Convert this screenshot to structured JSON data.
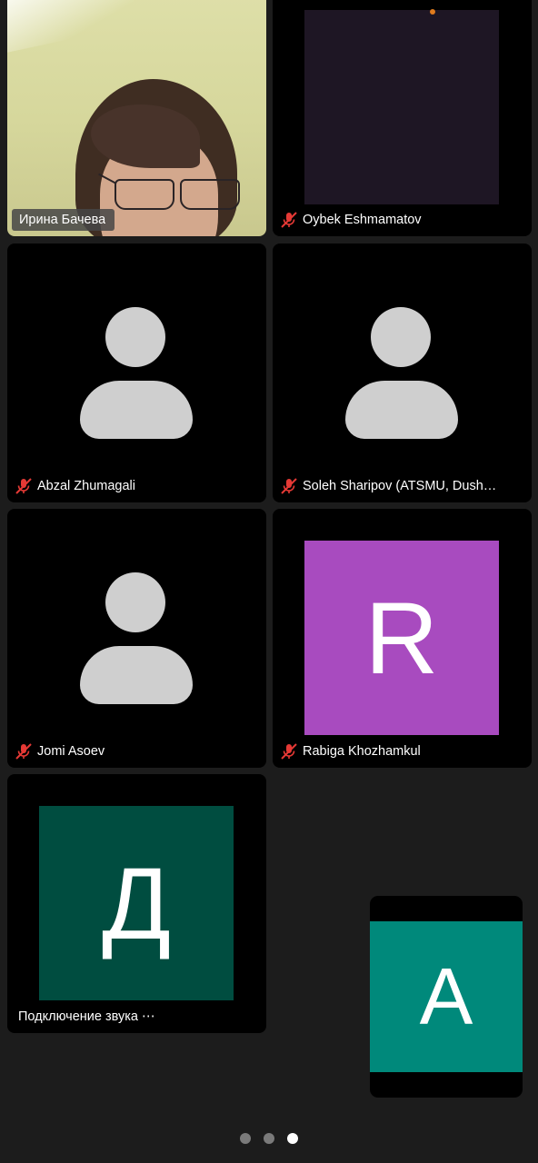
{
  "participants": [
    {
      "name": "Ирина Бачева",
      "muted": false,
      "kind": "video"
    },
    {
      "name": "Oybek Eshmamatov",
      "muted": true,
      "kind": "dark-video"
    },
    {
      "name": "Abzal Zhumagali",
      "muted": true,
      "kind": "avatar"
    },
    {
      "name": "Soleh Sharipov (ATSMU, Dush…",
      "muted": true,
      "kind": "avatar"
    },
    {
      "name": "Jomi Asoev",
      "muted": true,
      "kind": "avatar"
    },
    {
      "name": "Rabiga Khozhamkul",
      "muted": true,
      "kind": "initial",
      "initial": "R",
      "color": "#a84bbf"
    },
    {
      "name": "Подключение звука",
      "muted": false,
      "kind": "initial",
      "initial": "Д",
      "color": "#004d40",
      "status": "⋯"
    }
  ],
  "self_view": {
    "initial": "A",
    "color": "#00897b"
  },
  "pager": {
    "pages": 3,
    "current_page": 3
  },
  "icons": {
    "muted": "mic-off-icon",
    "avatar": "person-placeholder-icon"
  },
  "colors": {
    "background": "#1c1c1c",
    "tile": "#000000",
    "mute_red": "#e53935"
  }
}
